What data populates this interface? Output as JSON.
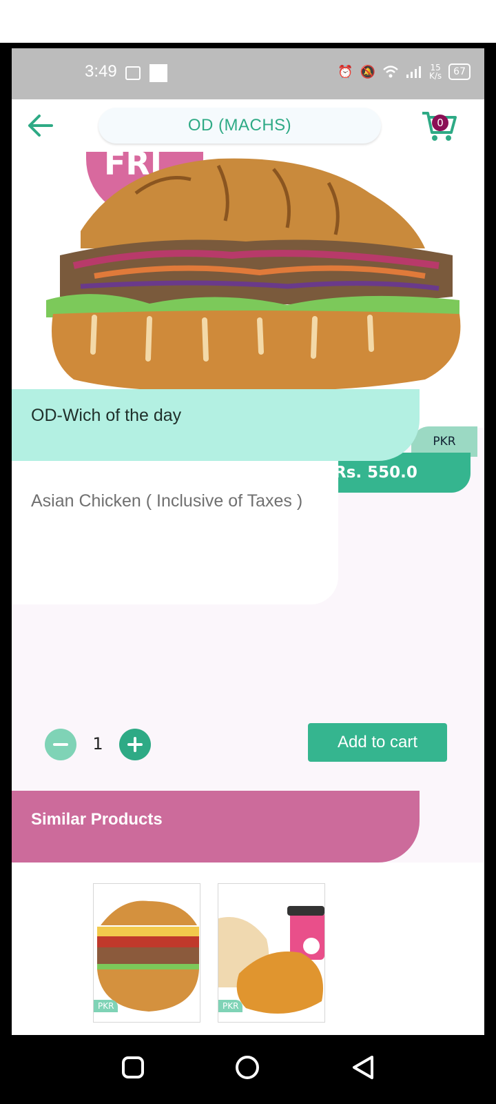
{
  "status_bar": {
    "time": "3:49",
    "network_speed_value": "15",
    "network_speed_unit": "K/s",
    "battery": "67"
  },
  "header": {
    "title": "OD (MACHS)",
    "cart_count": "0"
  },
  "product": {
    "badge_text": "FRI",
    "currency": "PKR",
    "price": "Rs. 550.0",
    "name": "OD-Wich of the day",
    "description": "Asian Chicken ( Inclusive of Taxes )",
    "quantity": "1"
  },
  "actions": {
    "add_to_cart_label": "Add to cart"
  },
  "similar": {
    "heading": "Similar Products",
    "items": [
      {
        "currency": "PKR"
      },
      {
        "currency": "PKR"
      }
    ]
  },
  "colors": {
    "accent_green": "#35b58f",
    "mint_band": "#b3f0e2",
    "pink_band": "#cc6b9b",
    "cart_badge": "#8b0f55"
  },
  "icons": [
    "back-arrow-icon",
    "cart-icon",
    "minus-icon",
    "plus-icon",
    "nav-recents-icon",
    "nav-home-icon",
    "nav-back-icon"
  ]
}
